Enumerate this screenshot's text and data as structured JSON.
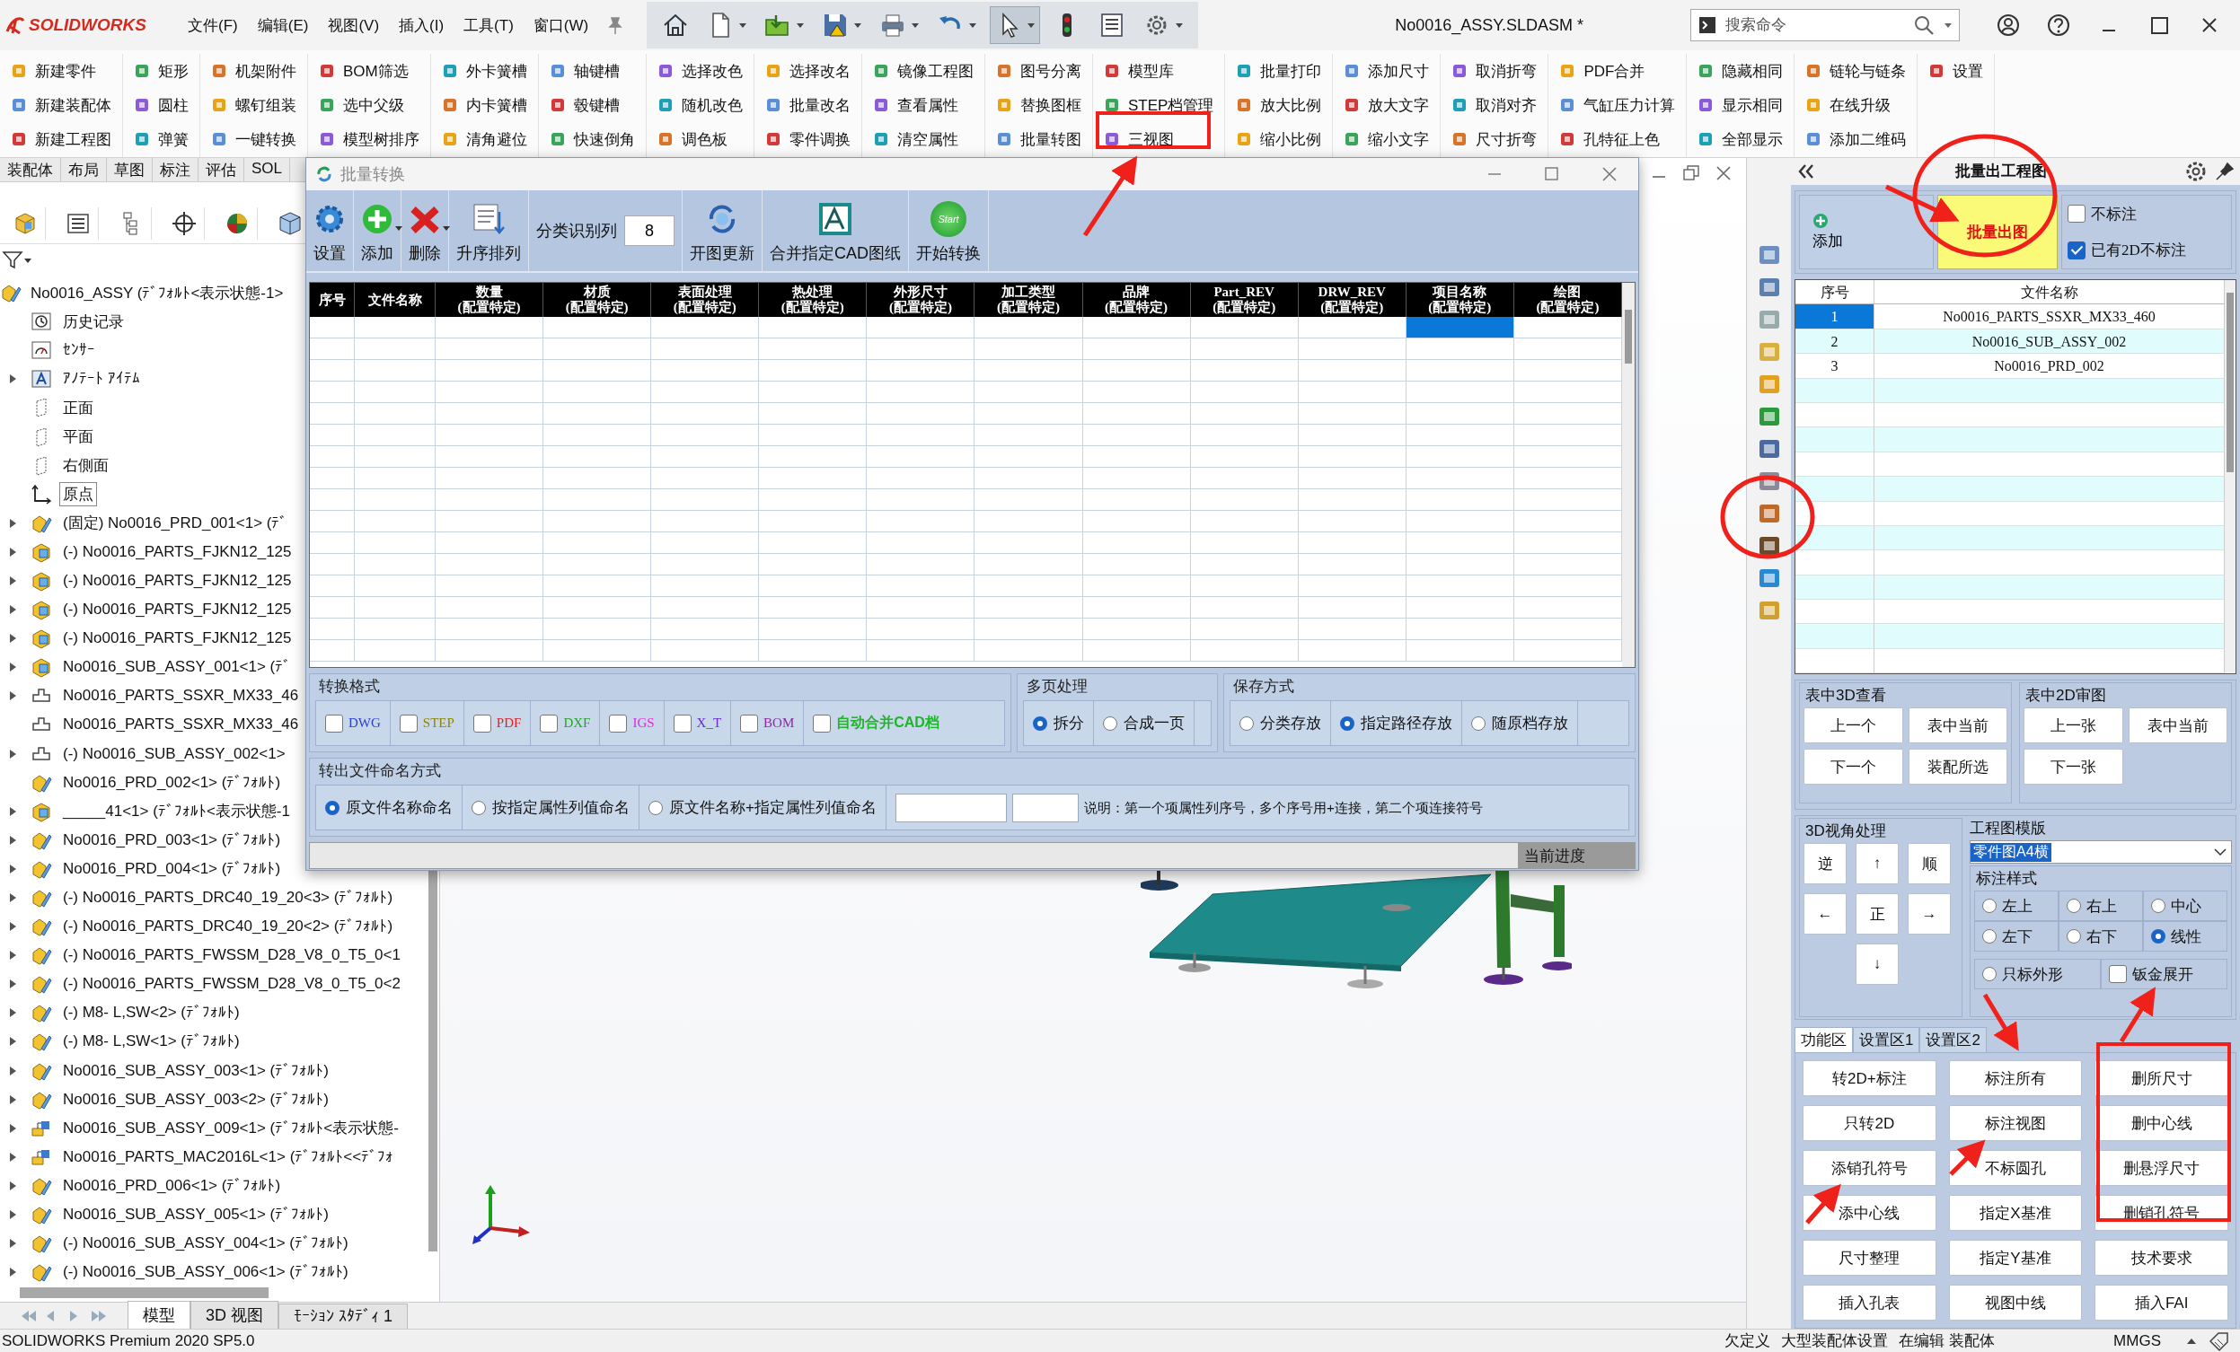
{
  "titlebar": {
    "logo": "SOLIDWORKS",
    "menus": [
      "文件(F)",
      "编辑(E)",
      "视图(V)",
      "插入(I)",
      "工具(T)",
      "窗口(W)"
    ],
    "document_title": "No0016_ASSY.SLDASM *",
    "search": {
      "placeholder": "搜索命令"
    }
  },
  "ribbon": {
    "columns": [
      [
        "新建零件",
        "新建装配体",
        "新建工程图"
      ],
      [
        "矩形",
        "圆柱",
        "弹簧"
      ],
      [
        "机架附件",
        "螺钉组装",
        "一键转换"
      ],
      [
        "BOM筛选",
        "选中父级",
        "模型树排序"
      ],
      [
        "外卡簧槽",
        "内卡簧槽",
        "清角避位"
      ],
      [
        "轴键槽",
        "毂键槽",
        "快速倒角"
      ],
      [
        "选择改色",
        "随机改色",
        "调色板"
      ],
      [
        "选择改名",
        "批量改名",
        "零件调换"
      ],
      [
        "镜像工程图",
        "查看属性",
        "清空属性"
      ],
      [
        "图号分离",
        "替换图框",
        "批量转图"
      ],
      [
        "模型库",
        "STEP档管理",
        "三视图"
      ],
      [
        "批量打印",
        "放大比例",
        "缩小比例"
      ],
      [
        "添加尺寸",
        "放大文字",
        "缩小文字"
      ],
      [
        "取消折弯",
        "取消对齐",
        "尺寸折弯"
      ],
      [
        "PDF合并",
        "气缸压力计算",
        "孔特征上色"
      ],
      [
        "隐藏相同",
        "显示相同",
        "全部显示"
      ],
      [
        "链轮与链条",
        "在线升级",
        "添加二维码"
      ],
      [
        "设置"
      ]
    ]
  },
  "command_tabs": [
    "装配体",
    "布局",
    "草图",
    "标注",
    "评估",
    "SOL"
  ],
  "feature_tree": {
    "root": {
      "label": "No0016_ASSY (ﾃﾞﾌｫﾙﾄ<表示状態-1>",
      "kind": "assembly",
      "children": [
        {
          "label": "历史记录",
          "kind": "history",
          "has_children": false,
          "selected": false
        },
        {
          "label": "ｾﾝｻｰ",
          "kind": "sensor",
          "has_children": false,
          "selected": false
        },
        {
          "label": "ｱﾉﾃｰﾄ ｱｲﾃﾑ",
          "kind": "annotation",
          "has_children": true,
          "selected": false
        },
        {
          "label": "正面",
          "kind": "plane",
          "has_children": false,
          "selected": false
        },
        {
          "label": "平面",
          "kind": "plane",
          "has_children": false,
          "selected": false
        },
        {
          "label": "右側面",
          "kind": "plane",
          "has_children": false,
          "selected": false
        },
        {
          "label": "原点",
          "kind": "origin",
          "has_children": false,
          "selected": true
        },
        {
          "label": "(固定) No0016_PRD_001<1> (ﾃﾞ",
          "kind": "assembly",
          "has_children": true,
          "selected": false
        },
        {
          "label": "(-) No0016_PARTS_FJKN12_125",
          "kind": "part",
          "has_children": true,
          "selected": false
        },
        {
          "label": "(-) No0016_PARTS_FJKN12_125",
          "kind": "part",
          "has_children": true,
          "selected": false
        },
        {
          "label": "(-) No0016_PARTS_FJKN12_125",
          "kind": "part",
          "has_children": true,
          "selected": false
        },
        {
          "label": "(-) No0016_PARTS_FJKN12_125",
          "kind": "part",
          "has_children": true,
          "selected": false
        },
        {
          "label": "No0016_SUB_ASSY_001<1> (ﾃﾞ",
          "kind": "part",
          "has_children": true,
          "selected": false
        },
        {
          "label": "No0016_PARTS_SSXR_MX33_46",
          "kind": "outline",
          "has_children": true,
          "selected": false
        },
        {
          "label": "No0016_PARTS_SSXR_MX33_46",
          "kind": "outline",
          "has_children": false,
          "selected": false
        },
        {
          "label": "(-) No0016_SUB_ASSY_002<1>",
          "kind": "outline",
          "has_children": true,
          "selected": false
        },
        {
          "label": "No0016_PRD_002<1> (ﾃﾞﾌｫﾙﾄ)",
          "kind": "assembly",
          "has_children": false,
          "selected": false
        },
        {
          "label": "_____41<1> (ﾃﾞﾌｫﾙﾄ<表示状態-1",
          "kind": "part",
          "has_children": true,
          "selected": false
        },
        {
          "label": "No0016_PRD_003<1> (ﾃﾞﾌｫﾙﾄ)",
          "kind": "assembly",
          "has_children": true,
          "selected": false
        },
        {
          "label": "No0016_PRD_004<1> (ﾃﾞﾌｫﾙﾄ)",
          "kind": "assembly",
          "has_children": true,
          "selected": false
        },
        {
          "label": "(-) No0016_PARTS_DRC40_19_20<3> (ﾃﾞﾌｫﾙﾄ)",
          "kind": "assembly",
          "has_children": true,
          "selected": false
        },
        {
          "label": "(-) No0016_PARTS_DRC40_19_20<2> (ﾃﾞﾌｫﾙﾄ)",
          "kind": "assembly",
          "has_children": true,
          "selected": false
        },
        {
          "label": "(-) No0016_PARTS_FWSSM_D28_V8_0_T5_0<1",
          "kind": "assembly",
          "has_children": true,
          "selected": false
        },
        {
          "label": "(-) No0016_PARTS_FWSSM_D28_V8_0_T5_0<2",
          "kind": "assembly",
          "has_children": true,
          "selected": false
        },
        {
          "label": "(-) M8-  L,SW<2> (ﾃﾞﾌｫﾙﾄ)",
          "kind": "assembly",
          "has_children": true,
          "selected": false
        },
        {
          "label": "(-) M8-  L,SW<1> (ﾃﾞﾌｫﾙﾄ)",
          "kind": "assembly",
          "has_children": true,
          "selected": false
        },
        {
          "label": "No0016_SUB_ASSY_003<1> (ﾃﾞﾌｫﾙﾄ)",
          "kind": "assembly",
          "has_children": true,
          "selected": false
        },
        {
          "label": "No0016_SUB_ASSY_003<2> (ﾃﾞﾌｫﾙﾄ)",
          "kind": "assembly",
          "has_children": true,
          "selected": false
        },
        {
          "label": "No0016_SUB_ASSY_009<1> (ﾃﾞﾌｫﾙﾄ<表示状態-",
          "kind": "flagged",
          "has_children": true,
          "selected": false
        },
        {
          "label": "No0016_PARTS_MAC2016L<1> (ﾃﾞﾌｫﾙﾄ<<ﾃﾞﾌｫ",
          "kind": "flagged",
          "has_children": true,
          "selected": false
        },
        {
          "label": "No0016_PRD_006<1> (ﾃﾞﾌｫﾙﾄ)",
          "kind": "assembly",
          "has_children": true,
          "selected": false
        },
        {
          "label": "No0016_SUB_ASSY_005<1> (ﾃﾞﾌｫﾙﾄ)",
          "kind": "assembly",
          "has_children": true,
          "selected": false
        },
        {
          "label": "(-) No0016_SUB_ASSY_004<1> (ﾃﾞﾌｫﾙﾄ)",
          "kind": "assembly",
          "has_children": true,
          "selected": false
        },
        {
          "label": "(-) No0016_SUB_ASSY_006<1> (ﾃﾞﾌｫﾙﾄ)",
          "kind": "assembly",
          "has_children": true,
          "selected": false
        }
      ]
    }
  },
  "model_tabs": [
    {
      "label": "模型",
      "selected": true
    },
    {
      "label": "3D 视图",
      "selected": false
    },
    {
      "label": "ﾓｰｼｮﾝ ｽﾀﾃﾞｨ 1",
      "selected": false
    }
  ],
  "dialog": {
    "title": "批量转换",
    "toolbar": [
      {
        "kind": "settings",
        "label": "设置",
        "dropdown": false
      },
      {
        "kind": "add",
        "label": "添加",
        "dropdown": true
      },
      {
        "kind": "delete",
        "label": "删除",
        "dropdown": true
      },
      {
        "kind": "sort",
        "label": "升序排列",
        "dropdown": false
      },
      {
        "kind": "field",
        "label": "分类识别列",
        "value": "8"
      },
      {
        "kind": "refresh",
        "label": "开图更新",
        "dropdown": false
      },
      {
        "kind": "merge",
        "label": "合并指定CAD图纸",
        "dropdown": false
      },
      {
        "kind": "start",
        "label": "开始转换",
        "badge": "Start",
        "dropdown": false
      }
    ],
    "grid": {
      "columns": [
        {
          "label": "序号",
          "selected": false
        },
        {
          "label": "文件名称",
          "selected": false
        },
        {
          "label": "数量",
          "sub": "(配置特定)",
          "selected": false
        },
        {
          "label": "材质",
          "sub": "(配置特定)",
          "selected": false
        },
        {
          "label": "表面处理",
          "sub": "(配置特定)",
          "selected": false
        },
        {
          "label": "热处理",
          "sub": "(配置特定)",
          "selected": false
        },
        {
          "label": "外形尺寸",
          "sub": "(配置特定)",
          "selected": false
        },
        {
          "label": "加工类型",
          "sub": "(配置特定)",
          "selected": false
        },
        {
          "label": "品牌",
          "sub": "(配置特定)",
          "selected": false
        },
        {
          "label": "Part_REV",
          "sub": "(配置特定)",
          "selected": false
        },
        {
          "label": "DRW_REV",
          "sub": "(配置特定)",
          "selected": false
        },
        {
          "label": "项目名称",
          "sub": "(配置特定)",
          "selected": true
        },
        {
          "label": "绘图",
          "sub": "(配置特定)",
          "selected": false
        }
      ]
    },
    "formats": {
      "title": "转换格式",
      "items": [
        {
          "label": "DWG",
          "color": "#2a3fd0",
          "checked": false,
          "kind": "format"
        },
        {
          "label": "STEP",
          "color": "#8f8500",
          "checked": false,
          "kind": "format"
        },
        {
          "label": "PDF",
          "color": "#e02424",
          "checked": false,
          "kind": "format"
        },
        {
          "label": "DXF",
          "color": "#22a52a",
          "checked": false,
          "kind": "format"
        },
        {
          "label": "IGS",
          "color": "#e028e0",
          "checked": false,
          "kind": "format"
        },
        {
          "label": "X_T",
          "color": "#6a2ad0",
          "checked": false,
          "kind": "format"
        },
        {
          "label": "BOM",
          "color": "#8a2aa8",
          "checked": false,
          "kind": "format"
        },
        {
          "label": "自动合并CAD档",
          "color": "#1fb52a",
          "checked": false,
          "kind": "auto"
        }
      ]
    },
    "multipage": {
      "title": "多页处理",
      "options": [
        {
          "label": "拆分",
          "selected": true
        },
        {
          "label": "合成一页",
          "selected": false
        }
      ]
    },
    "save": {
      "title": "保存方式",
      "options": [
        {
          "label": "分类存放",
          "selected": false
        },
        {
          "label": "指定路径存放",
          "selected": true
        },
        {
          "label": "随原档存放",
          "selected": false
        }
      ]
    },
    "naming": {
      "title": "转出文件命名方式",
      "options": [
        {
          "label": "原文件名称命名",
          "selected": true
        },
        {
          "label": "按指定属性列值命名",
          "selected": false
        },
        {
          "label": "原文件名称+指定属性列值命名",
          "selected": false
        }
      ],
      "note": "说明：第一个项属性列序号，多个序号用+连接，第二个项连接符号"
    },
    "progress": {
      "label": "当前进度",
      "level": 0
    }
  },
  "task_pane": {
    "title": "批量出工程图",
    "add_button": "添加",
    "run_button": "批量出图",
    "options": [
      {
        "label": "不标注",
        "checked": false
      },
      {
        "label": "已有2D不标注",
        "checked": true
      }
    ],
    "table": {
      "columns": [
        "序号",
        "文件名称"
      ],
      "rows": [
        {
          "cells": [
            "1",
            "No0016_PARTS_SSXR_MX33_460"
          ],
          "selected": true
        },
        {
          "cells": [
            "2",
            "No0016_SUB_ASSY_002"
          ],
          "selected": false
        },
        {
          "cells": [
            "3",
            "No0016_PRD_002"
          ],
          "selected": false
        }
      ]
    },
    "view3d": {
      "title": "表中3D查看",
      "buttons": [
        "上一个",
        "表中当前",
        "下一个",
        "装配所选"
      ]
    },
    "review2d": {
      "title": "表中2D审图",
      "buttons": [
        "上一张",
        "表中当前",
        "下一张"
      ]
    },
    "view_angle": {
      "title": "3D视角处理",
      "buttons": [
        "逆",
        "↑",
        "顺",
        "←",
        "正",
        "→",
        "↓"
      ]
    },
    "template": {
      "title": "工程图模版",
      "value": "零件图A4横"
    },
    "dim_style": {
      "title": "标注样式",
      "options": [
        {
          "label": "左上",
          "selected": false
        },
        {
          "label": "右上",
          "selected": false
        },
        {
          "label": "中心",
          "selected": false
        },
        {
          "label": "左下",
          "selected": false
        },
        {
          "label": "右下",
          "selected": false
        },
        {
          "label": "线性",
          "selected": true
        }
      ],
      "outline_only": {
        "label": "只标外形",
        "selected": false
      },
      "sheet_metal": {
        "label": "钣金展开",
        "checked": false
      }
    },
    "tabs": [
      {
        "label": "功能区",
        "selected": true
      },
      {
        "label": "设置区1",
        "selected": false
      },
      {
        "label": "设置区2",
        "selected": false
      }
    ],
    "functions": [
      "转2D+标注",
      "标注所有",
      "删所尺寸",
      "只转2D",
      "标注视图",
      "删中心线",
      "添销孔符号",
      "不标圆孔",
      "删悬浮尺寸",
      "添中心线",
      "指定X基准",
      "删销孔符号",
      "尺寸整理",
      "指定Y基准",
      "技术要求",
      "插入孔表",
      "视图中线",
      "插入FAI"
    ]
  },
  "status_bar": {
    "product": "SOLIDWORKS Premium 2020 SP5.0",
    "items": [
      "欠定义",
      "大型装配体设置",
      "在编辑 装配体",
      "MMGS"
    ]
  }
}
